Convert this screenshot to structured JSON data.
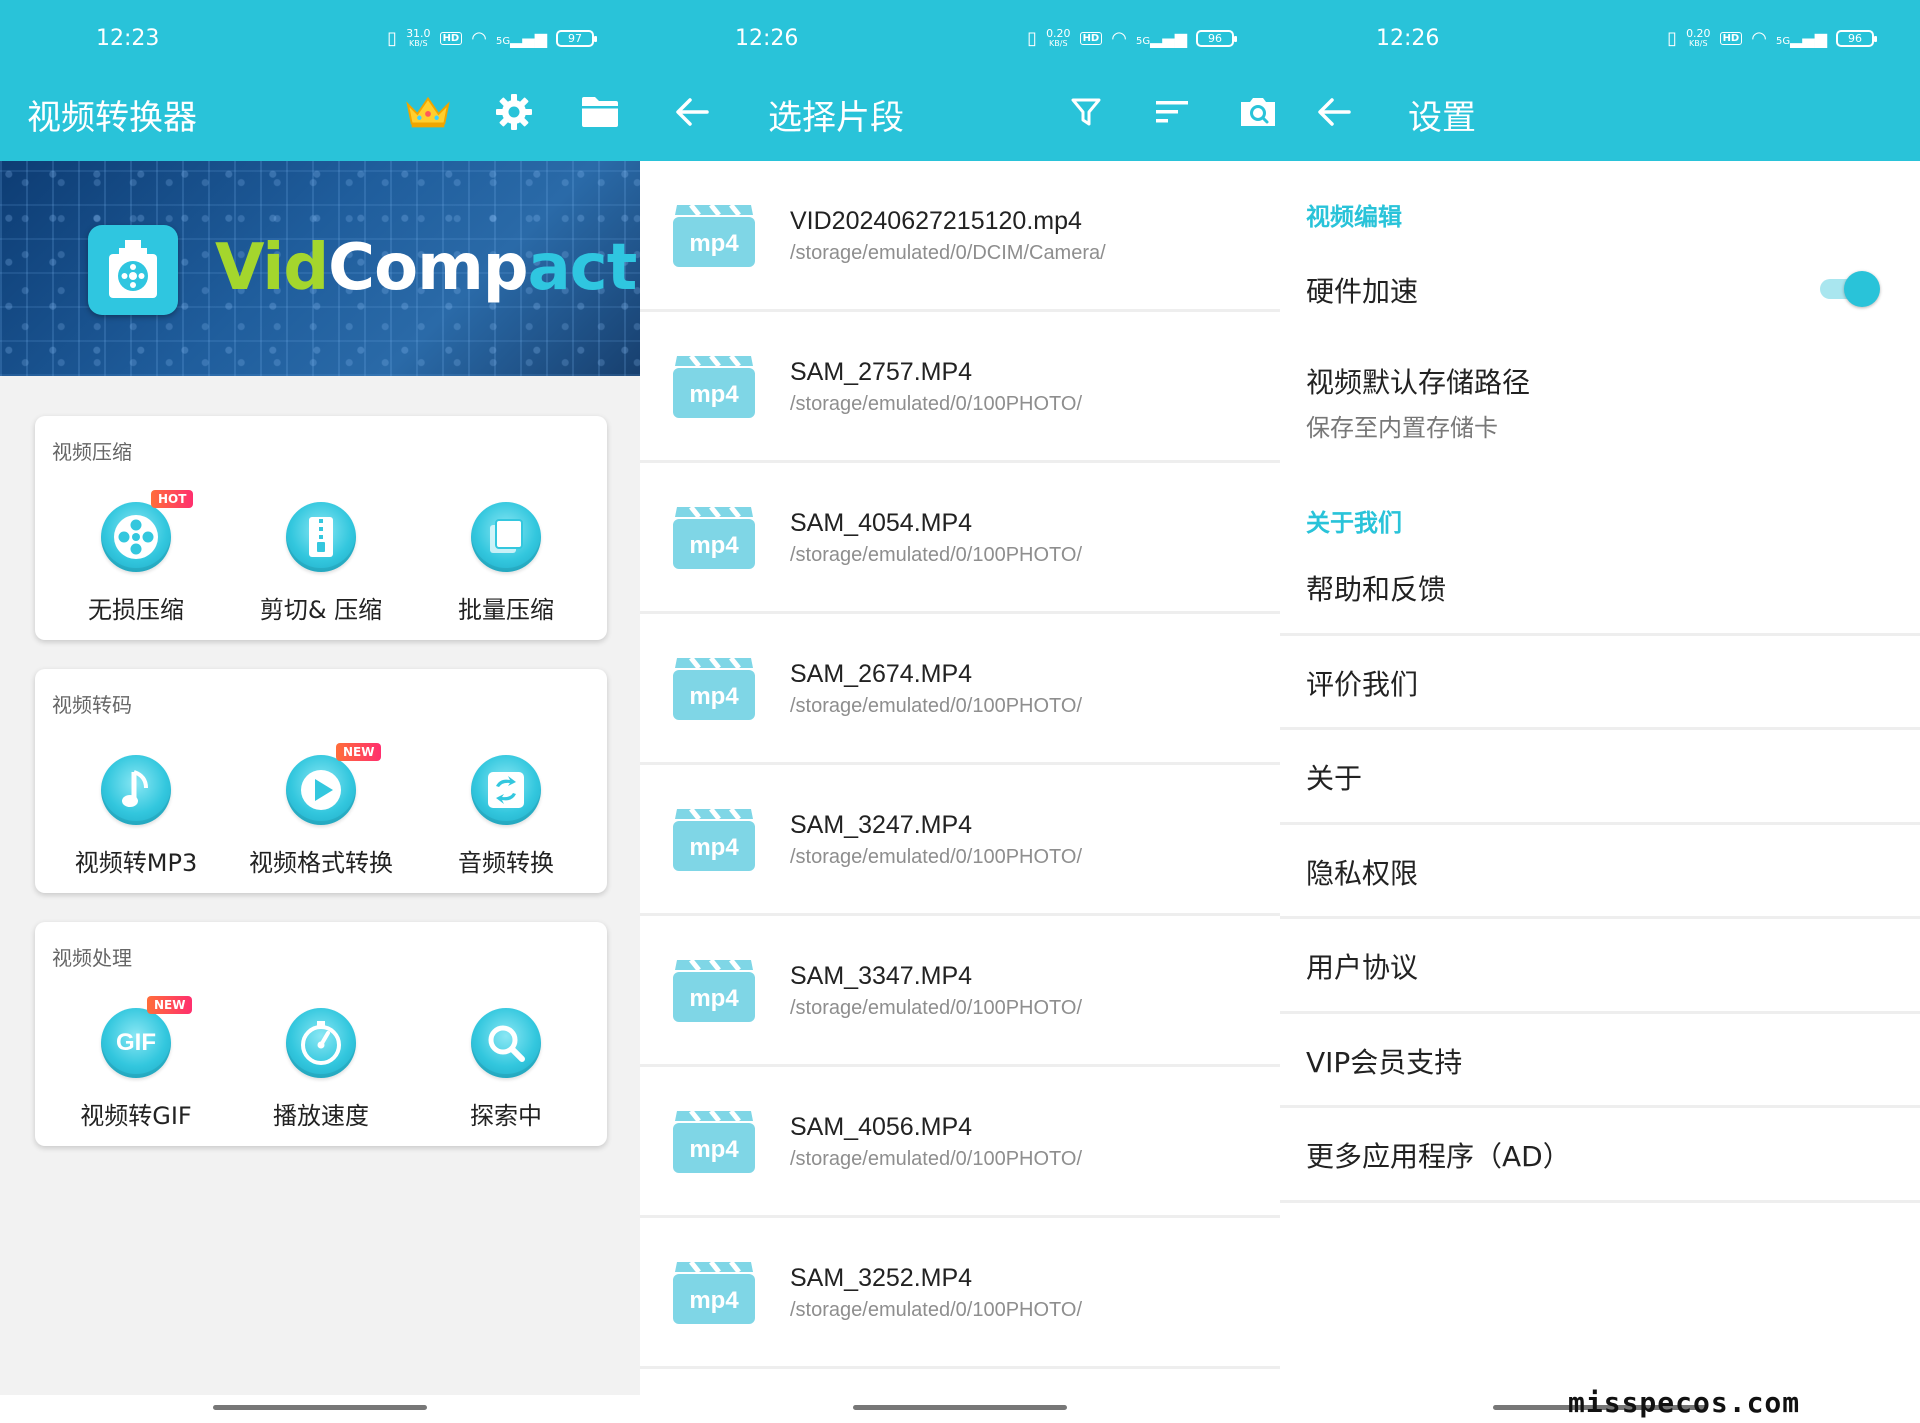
{
  "colors": {
    "accent": "#29c3d9",
    "hot_badge": "#ff2f6e",
    "logo_green": "#a4d62d",
    "background": "#f2f2f2"
  },
  "screen1": {
    "status": {
      "time": "12:23",
      "net_speed": "31.0",
      "net_unit": "KB/S",
      "hd": "HD",
      "signal": "5G",
      "battery": "97"
    },
    "app_title": "视频转换器",
    "toolbar_icons": [
      "crown-icon",
      "gear-icon",
      "folder-icon"
    ],
    "banner": {
      "logo_part1": "Vid",
      "logo_part2": "Comp",
      "logo_part3": "act"
    },
    "sections": [
      {
        "title": "视频压缩",
        "items": [
          {
            "label": "无损压缩",
            "icon": "film-reel-icon",
            "badge": "HOT"
          },
          {
            "label": "剪切& 压缩",
            "icon": "zip-icon",
            "badge": ""
          },
          {
            "label": "批量压缩",
            "icon": "stack-icon",
            "badge": ""
          }
        ]
      },
      {
        "title": "视频转码",
        "items": [
          {
            "label": "视频转MP3",
            "icon": "music-note-icon",
            "badge": ""
          },
          {
            "label": "视频格式转换",
            "icon": "play-icon",
            "badge": "NEW"
          },
          {
            "label": "音频转换",
            "icon": "convert-icon",
            "badge": ""
          }
        ]
      },
      {
        "title": "视频处理",
        "items": [
          {
            "label": "视频转GIF",
            "icon": "gif-icon",
            "icon_text": "GIF",
            "badge": "NEW"
          },
          {
            "label": "播放速度",
            "icon": "speedometer-icon",
            "badge": ""
          },
          {
            "label": "探索中",
            "icon": "magnifier-icon",
            "badge": ""
          }
        ]
      }
    ]
  },
  "screen2": {
    "status": {
      "time": "12:26",
      "net_speed": "0.20",
      "net_unit": "KB/S",
      "hd": "HD",
      "signal": "5G",
      "battery": "96"
    },
    "title": "选择片段",
    "toolbar_icons": [
      "filter-icon",
      "sort-icon",
      "image-search-icon"
    ],
    "file_badge": "mp4",
    "files": [
      {
        "name": "VID20240627215120.mp4",
        "path": "/storage/emulated/0/DCIM/Camera/"
      },
      {
        "name": "SAM_2757.MP4",
        "path": "/storage/emulated/0/100PHOTO/"
      },
      {
        "name": "SAM_4054.MP4",
        "path": "/storage/emulated/0/100PHOTO/"
      },
      {
        "name": "SAM_2674.MP4",
        "path": "/storage/emulated/0/100PHOTO/"
      },
      {
        "name": "SAM_3247.MP4",
        "path": "/storage/emulated/0/100PHOTO/"
      },
      {
        "name": "SAM_3347.MP4",
        "path": "/storage/emulated/0/100PHOTO/"
      },
      {
        "name": "SAM_4056.MP4",
        "path": "/storage/emulated/0/100PHOTO/"
      },
      {
        "name": "SAM_3252.MP4",
        "path": "/storage/emulated/0/100PHOTO/"
      }
    ]
  },
  "screen3": {
    "status": {
      "time": "12:26",
      "net_speed": "0.20",
      "net_unit": "KB/S",
      "hd": "HD",
      "signal": "5G",
      "battery": "96"
    },
    "title": "设置",
    "section_video": "视频编辑",
    "hardware_accel": {
      "label": "硬件加速",
      "enabled": true
    },
    "storage_path": {
      "label": "视频默认存储路径",
      "value": "保存至内置存储卡"
    },
    "section_about": "关于我们",
    "items": [
      "帮助和反馈",
      "评价我们",
      "关于",
      "隐私权限",
      "用户协议",
      "VIP会员支持",
      "更多应用程序（AD）"
    ]
  },
  "watermark": "misspecos.com"
}
